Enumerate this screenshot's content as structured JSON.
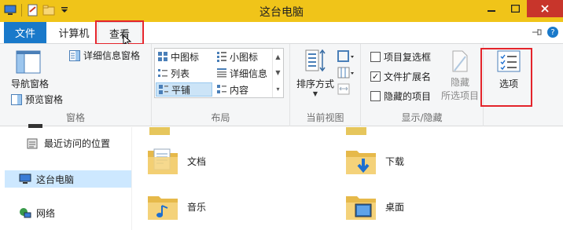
{
  "window": {
    "title": "这台电脑",
    "accent_color": "#f0c419",
    "close_color": "#c8352b"
  },
  "tabs": {
    "file": "文件",
    "computer": "计算机",
    "view": "查看"
  },
  "ribbon": {
    "panes": {
      "navigation_pane": "导航窗格",
      "preview_pane": "预览窗格",
      "details_pane": "详细信息窗格",
      "group_label": "窗格"
    },
    "layout": {
      "items": [
        {
          "label": "中图标",
          "selected": false
        },
        {
          "label": "小图标",
          "selected": false
        },
        {
          "label": "列表",
          "selected": false
        },
        {
          "label": "详细信息",
          "selected": false
        },
        {
          "label": "平铺",
          "selected": true
        },
        {
          "label": "内容",
          "selected": false
        }
      ],
      "group_label": "布局"
    },
    "current_view": {
      "sort_by": "排序方式",
      "group_label": "当前视图"
    },
    "show_hide": {
      "item_checkboxes": {
        "label": "项目复选框",
        "checked": false
      },
      "file_extensions": {
        "label": "文件扩展名",
        "checked": true
      },
      "hidden_items": {
        "label": "隐藏的项目",
        "checked": false
      },
      "hide_selected": "隐藏\n所选项目",
      "hide_label": "隐藏",
      "selected_items_label": "所选项目",
      "group_label": "显示/隐藏"
    },
    "options": {
      "label": "选项"
    }
  },
  "nav": {
    "recent": "最近访问的位置",
    "this_pc": "这台电脑",
    "network": "网络"
  },
  "files": [
    {
      "name": "文档",
      "icon": "documents-folder-icon"
    },
    {
      "name": "下载",
      "icon": "downloads-folder-icon"
    },
    {
      "name": "音乐",
      "icon": "music-folder-icon"
    },
    {
      "name": "桌面",
      "icon": "desktop-folder-icon"
    }
  ]
}
